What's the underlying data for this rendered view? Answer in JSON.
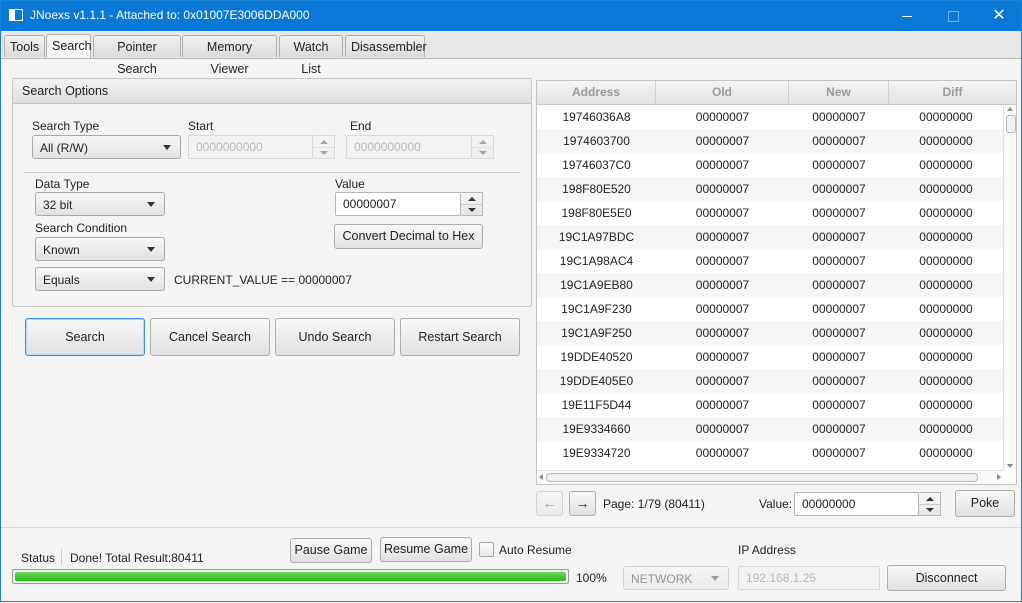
{
  "window": {
    "title": "JNoexs v1.1.1 - Attached to: 0x01007E3006DDA000"
  },
  "tabs": [
    {
      "label": "Tools"
    },
    {
      "label": "Search"
    },
    {
      "label": "Pointer Search"
    },
    {
      "label": "Memory Viewer"
    },
    {
      "label": "Watch List"
    },
    {
      "label": "Disassembler"
    }
  ],
  "search_options": {
    "header": "Search Options",
    "search_type_label": "Search Type",
    "search_type_value": "All (R/W)",
    "start_label": "Start",
    "start_value": "0000000000",
    "end_label": "End",
    "end_value": "0000000000",
    "data_type_label": "Data Type",
    "data_type_value": "32 bit",
    "value_label": "Value",
    "value_value": "00000007",
    "search_condition_label": "Search Condition",
    "search_condition_value": "Known",
    "convert_button": "Convert Decimal to Hex",
    "comparison_value": "Equals",
    "condition_text": "CURRENT_VALUE == 00000007"
  },
  "actions": {
    "search": "Search",
    "cancel": "Cancel Search",
    "undo": "Undo Search",
    "restart": "Restart Search"
  },
  "results": {
    "columns": [
      "Address",
      "Old",
      "New",
      "Diff"
    ],
    "rows": [
      [
        "19746036A8",
        "00000007",
        "00000007",
        "00000000"
      ],
      [
        "1974603700",
        "00000007",
        "00000007",
        "00000000"
      ],
      [
        "19746037C0",
        "00000007",
        "00000007",
        "00000000"
      ],
      [
        "198F80E520",
        "00000007",
        "00000007",
        "00000000"
      ],
      [
        "198F80E5E0",
        "00000007",
        "00000007",
        "00000000"
      ],
      [
        "19C1A97BDC",
        "00000007",
        "00000007",
        "00000000"
      ],
      [
        "19C1A98AC4",
        "00000007",
        "00000007",
        "00000000"
      ],
      [
        "19C1A9EB80",
        "00000007",
        "00000007",
        "00000000"
      ],
      [
        "19C1A9F230",
        "00000007",
        "00000007",
        "00000000"
      ],
      [
        "19C1A9F250",
        "00000007",
        "00000007",
        "00000000"
      ],
      [
        "19DDE40520",
        "00000007",
        "00000007",
        "00000000"
      ],
      [
        "19DDE405E0",
        "00000007",
        "00000007",
        "00000000"
      ],
      [
        "19E11F5D44",
        "00000007",
        "00000007",
        "00000000"
      ],
      [
        "19E9334660",
        "00000007",
        "00000007",
        "00000000"
      ],
      [
        "19E9334720",
        "00000007",
        "00000007",
        "00000000"
      ]
    ],
    "page_text": "Page: 1/79 (80411)",
    "value_label": "Value:",
    "value_input": "00000000",
    "poke_button": "Poke"
  },
  "status": {
    "label": "Status",
    "message": "Done! Total Result:80411",
    "progress_percent": 100,
    "progress_text": "100%",
    "pause_button": "Pause Game",
    "resume_button": "Resume Game",
    "auto_resume_label": "Auto Resume",
    "connection_type": "NETWORK",
    "ip_label": "IP Address",
    "ip_value": "192.168.1.25",
    "disconnect_button": "Disconnect"
  },
  "colors": {
    "title_bar": "#0a78d7",
    "progress": "#27b818"
  }
}
